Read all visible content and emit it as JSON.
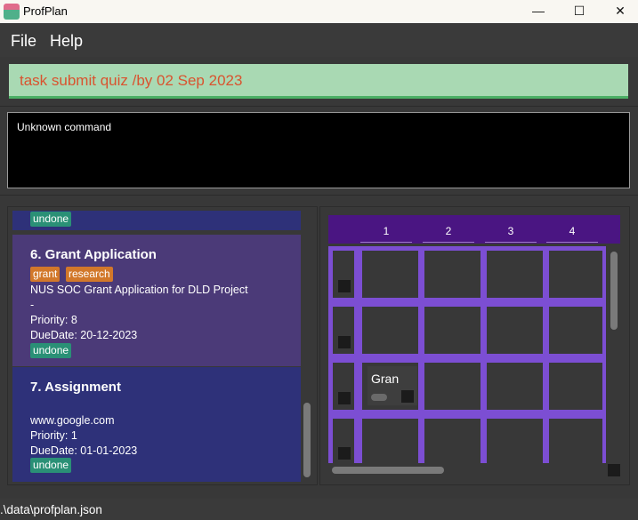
{
  "window": {
    "title": "ProfPlan",
    "minimize_glyph": "—",
    "maximize_glyph": "☐",
    "close_glyph": "✕"
  },
  "menu": {
    "items": [
      "File",
      "Help"
    ]
  },
  "command": {
    "value": "task submit quiz /by 02 Sep 2023"
  },
  "result": {
    "text": "Unknown command"
  },
  "tasks": [
    {
      "status": "undone"
    },
    {
      "index_title": "6.  Grant Application",
      "tags": [
        "grant",
        "research"
      ],
      "description": "NUS SOC Grant Application for DLD Project",
      "link": "-",
      "priority": "Priority: 8",
      "due": "DueDate: 20-12-2023",
      "status": "undone"
    },
    {
      "index_title": "7.  Assignment",
      "link": "www.google.com",
      "priority": "Priority: 1",
      "due": "DueDate: 01-01-2023",
      "status": "undone"
    }
  ],
  "calendar": {
    "days": [
      "1",
      "2",
      "3",
      "4"
    ],
    "event_text": "Gran"
  },
  "status_bar": {
    "path": ".\\data\\profplan.json"
  },
  "colors": {
    "accent_purple": "#7c4ed3",
    "header_purple": "#4a1582",
    "command_bg": "#a9d9b3",
    "command_text": "#d9532f",
    "status_badge": "#2a9076",
    "tag_badge": "#d2782a"
  },
  "icons": [
    "app-logo-icon",
    "minimize-icon",
    "maximize-icon",
    "close-icon"
  ]
}
